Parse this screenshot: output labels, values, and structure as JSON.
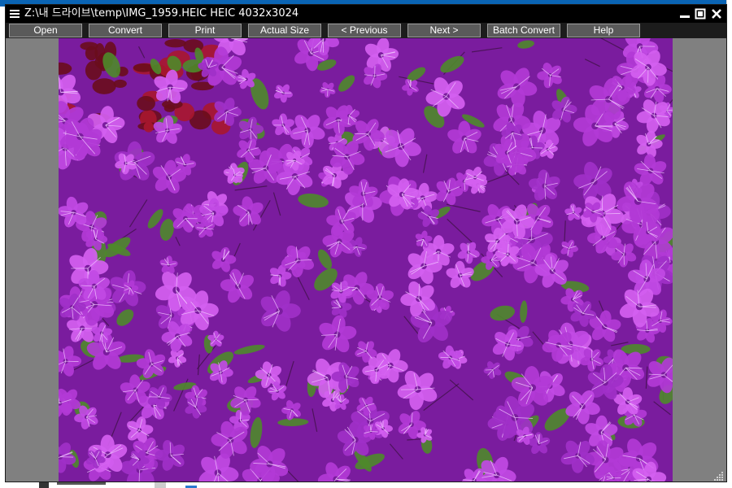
{
  "window": {
    "title": "Z:\\내 드라이브\\temp\\IMG_1959.HEIC HEIC 4032x3024"
  },
  "toolbar": {
    "buttons": [
      {
        "label": "Open"
      },
      {
        "label": "Convert"
      },
      {
        "label": "Print"
      },
      {
        "label": "Actual Size"
      },
      {
        "label": "< Previous"
      },
      {
        "label": "Next >"
      },
      {
        "label": "Batch Convert"
      },
      {
        "label": "Help"
      }
    ]
  },
  "image": {
    "subject": "purple azalea flowers",
    "colors": {
      "petal": "#b23ad6",
      "petal_light": "#d460f0",
      "petal_dark": "#7a1c9e",
      "leaf": "#4e8a2a",
      "red_flowers": "#a8172e"
    }
  },
  "colors": {
    "titlebar_bg": "#000000",
    "toolbar_bg": "#1c1c1c",
    "button_bg": "#5a5a5a",
    "viewer_bg": "#808080"
  }
}
